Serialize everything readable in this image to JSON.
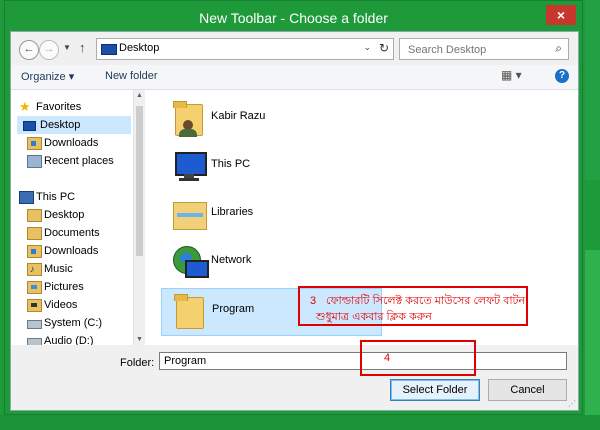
{
  "window": {
    "title": "New Toolbar - Choose a folder",
    "close_glyph": "×"
  },
  "address_bar": {
    "path": "Desktop",
    "search_placeholder": "Search Desktop"
  },
  "toolbar": {
    "organize_label": "Organize ▾",
    "new_folder_label": "New folder",
    "views_glyph": "▦ ▾",
    "help_glyph": "?"
  },
  "nav": {
    "favorites_header": "Favorites",
    "favorites": [
      {
        "label": "Desktop",
        "icon": "desktop-icon",
        "selected": true
      },
      {
        "label": "Downloads",
        "icon": "downloads-folder-icon"
      },
      {
        "label": "Recent places",
        "icon": "recent-places-icon"
      }
    ],
    "this_pc_header": "This PC",
    "this_pc": [
      {
        "label": "Desktop",
        "icon": "folder-icon"
      },
      {
        "label": "Documents",
        "icon": "documents-folder-icon"
      },
      {
        "label": "Downloads",
        "icon": "downloads-folder-icon"
      },
      {
        "label": "Music",
        "icon": "music-folder-icon"
      },
      {
        "label": "Pictures",
        "icon": "pictures-folder-icon"
      },
      {
        "label": "Videos",
        "icon": "videos-folder-icon"
      },
      {
        "label": "System (C:)",
        "icon": "drive-icon"
      },
      {
        "label": "Audio (D:)",
        "icon": "drive-icon"
      }
    ]
  },
  "files": [
    {
      "label": "Kabir Razu",
      "icon": "user-folder-icon"
    },
    {
      "label": "This PC",
      "icon": "computer-icon"
    },
    {
      "label": "Libraries",
      "icon": "libraries-icon"
    },
    {
      "label": "Network",
      "icon": "network-icon"
    },
    {
      "label": "Program",
      "icon": "folder-icon",
      "selected": true
    }
  ],
  "annotations": {
    "step3_number": "3",
    "step3_line1": "ফোল্ডারটি সিলেক্ট করতে মাউসের লেফট বাটন",
    "step3_line2": "শুধুমাত্র একবার ক্লিক করুন",
    "step4_number": "4",
    "color": "#e10000"
  },
  "footer": {
    "folder_label": "Folder:",
    "folder_value": "Program",
    "select_button": "Select Folder",
    "cancel_button": "Cancel"
  }
}
